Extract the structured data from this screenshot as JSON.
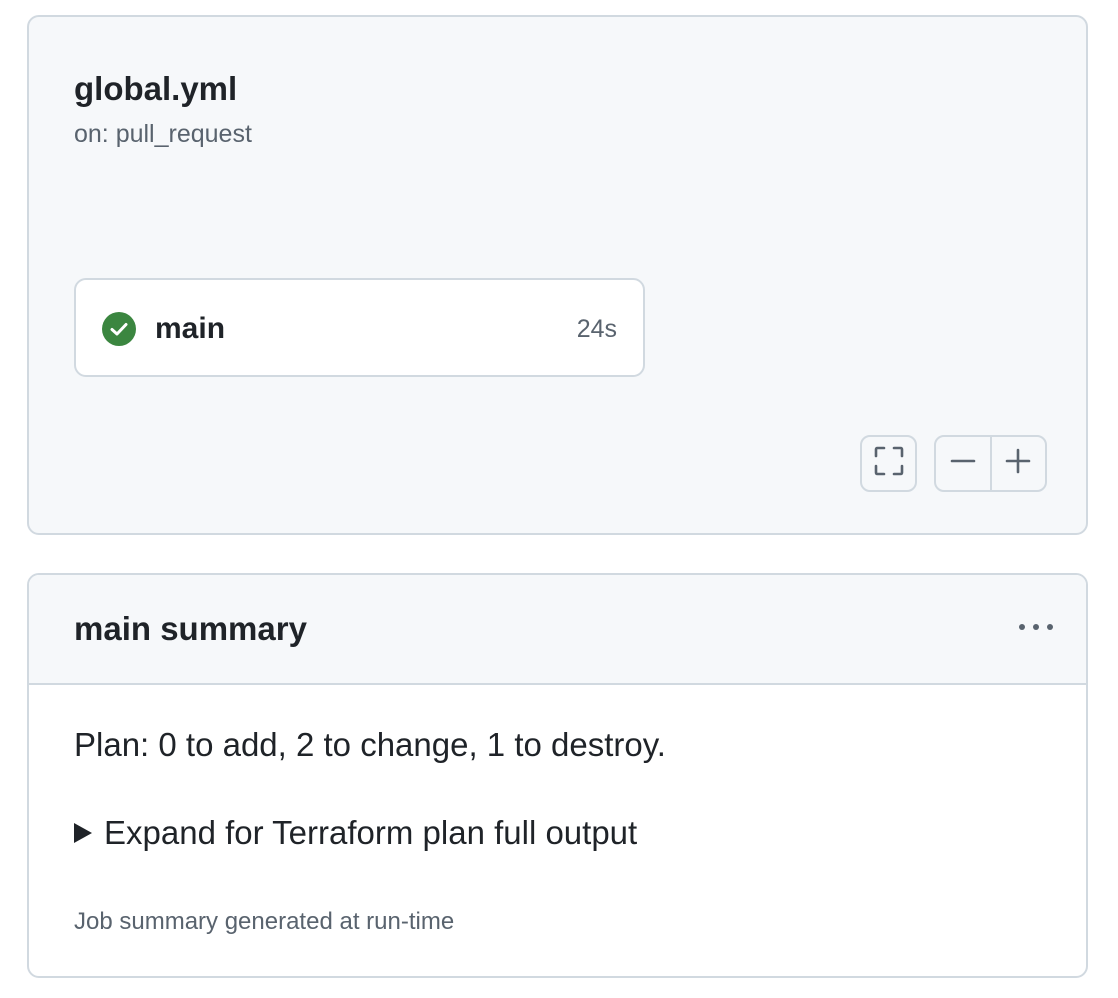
{
  "workflow": {
    "file_name": "global.yml",
    "trigger": "on: pull_request",
    "job": {
      "name": "main",
      "duration": "24s",
      "status_icon": "check-circle-fill-icon",
      "status_color": "#3b8640"
    },
    "controls": {
      "fullscreen_icon": "screen-full-icon",
      "zoom_out_icon": "minus-icon",
      "zoom_in_icon": "plus-icon"
    }
  },
  "summary": {
    "title": "main summary",
    "menu_icon": "kebab-horizontal-icon",
    "plan_text": "Plan: 0 to add, 2 to change, 1 to destroy.",
    "details_label": "Expand for Terraform plan full output",
    "footer_text": "Job summary generated at run-time"
  },
  "colors": {
    "canvas_bg": "#f6f8fa",
    "border": "#d1d9e0",
    "text_primary": "#1f2328",
    "text_muted": "#59636e",
    "success": "#3b8640"
  }
}
